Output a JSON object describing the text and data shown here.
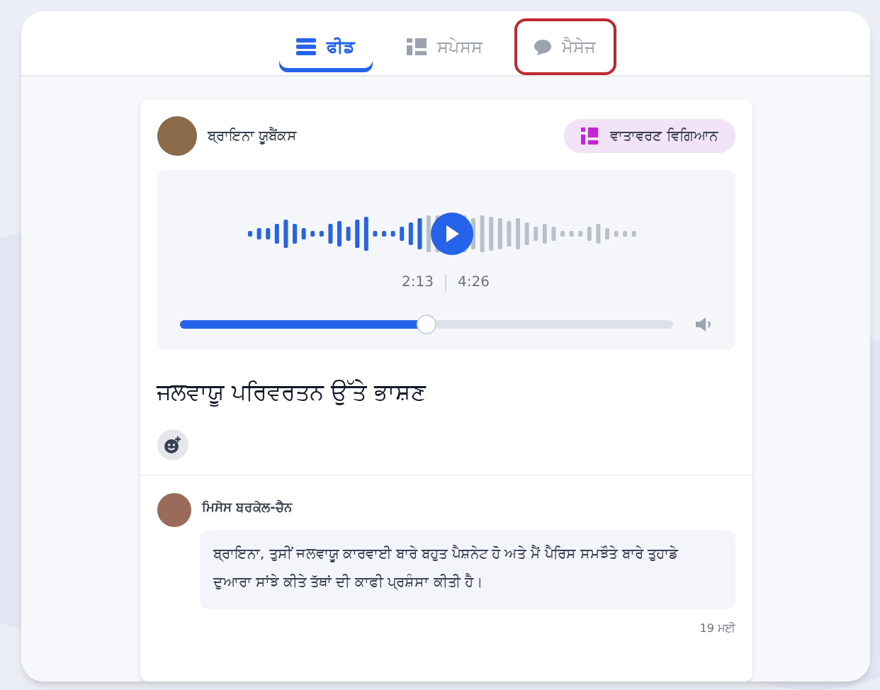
{
  "tabs": [
    {
      "label": "ਫੀਡ",
      "kind": "feed",
      "selected": true,
      "highlighted": false
    },
    {
      "label": "ਸਪੇਸਸ",
      "kind": "spaces",
      "selected": false,
      "highlighted": false
    },
    {
      "label": "ਮੈਸੇਜ",
      "kind": "chat",
      "selected": false,
      "highlighted": true
    }
  ],
  "post": {
    "author": "ਬ੍ਰਾਇਨਾ ਯੂਬੈਂਕਸ",
    "tag": "ਵਾਤਾਵਰਣ ਵਿਗਿਆਨ",
    "audio": {
      "elapsed": "2:13",
      "duration": "4:26",
      "level": 0.5
    },
    "title": "ਜਲਵਾਯੂ ਪਰਿਵਰਤਨ ਉੱਤੇ ਭਾਸ਼ਣ"
  },
  "comments": [
    {
      "author": "ਮਿਸੇਸ ਬਰਕੇਲ-ਚੈਨ",
      "text": "ਬ੍ਰਾਇਨਾ, ਤੁਸੀਂ ਜਲਵਾਯੂ ਕਾਰਵਾਈ ਬਾਰੇ ਬਹੁਤ ਪੈਸ਼ਨੇਟ ਹੋ ਅਤੇ ਮੈਂ ਪੈਰਿਸ ਸਮਝੌਤੇ ਬਾਰੇ ਤੁਹਾਡੇ ਦੁਆਰਾ ਸਾਂਝੇ ਕੀਤੇ ਤੱਥਾਂ ਦੀ ਕਾਫੀ ਪ੍ਰਸ਼ੰਸਾ ਕੀਤੀ ਹੈ।",
      "date": "19 ਮਈ"
    }
  ]
}
